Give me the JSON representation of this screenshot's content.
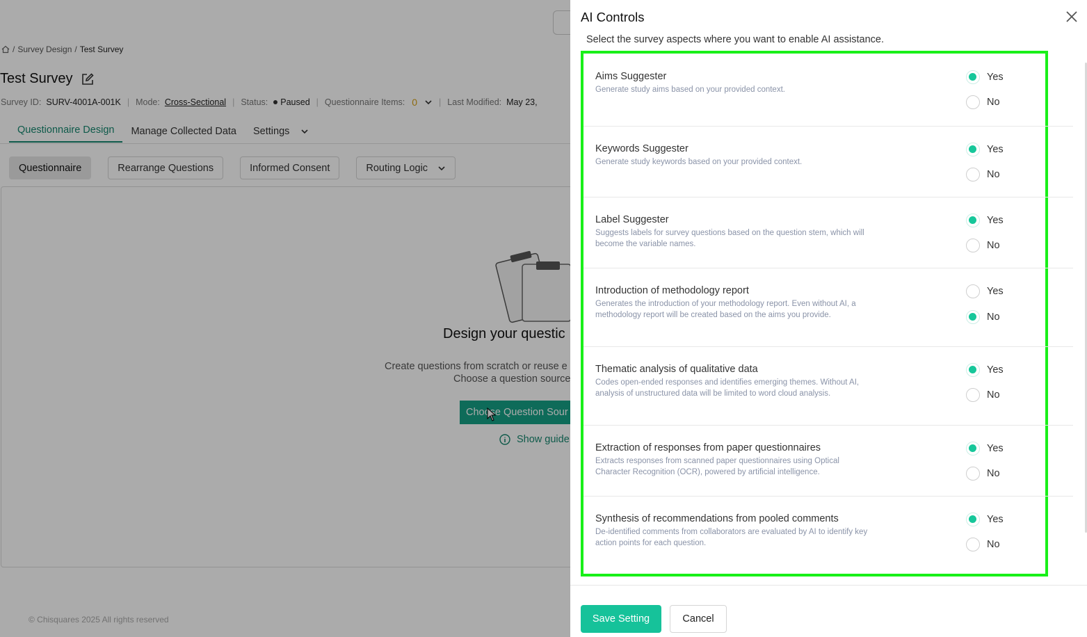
{
  "background": {
    "breadcrumb": [
      "/",
      "Survey Design",
      "/",
      "Test Survey"
    ],
    "title": "Test Survey",
    "meta": {
      "survey_id_label": "Survey ID:",
      "survey_id": "SURV-4001A-001K",
      "mode_label": "Mode:",
      "mode": "Cross-Sectional",
      "status_label": "Status:",
      "status": "Paused",
      "items_label": "Questionnaire Items:",
      "items": "0",
      "modified_label": "Last Modified:",
      "modified": "May 23,"
    },
    "tabs": [
      "Questionnaire Design",
      "Manage Collected Data",
      "Settings"
    ],
    "subtabs": [
      "Questionnaire",
      "Rearrange Questions",
      "Informed Consent",
      "Routing Logic"
    ],
    "empty_title": "Design your questic",
    "empty_desc": "Create questions from scratch or reuse e",
    "empty_desc2": "Choose a question source",
    "choose_button": "Choose Question Sour",
    "guide": "Show guide",
    "footer": "© Chisquares 2025 All rights reserved"
  },
  "drawer": {
    "title": "AI Controls",
    "subtitle": "Select the survey aspects where you want to enable AI assistance.",
    "yes_label": "Yes",
    "no_label": "No",
    "items": [
      {
        "title": "Aims Suggester",
        "desc": "Generate study aims based on your provided context.",
        "selected": "Yes"
      },
      {
        "title": "Keywords Suggester",
        "desc": "Generate study keywords based on your provided context.",
        "selected": "Yes"
      },
      {
        "title": "Label Suggester",
        "desc": "Suggests labels for survey questions based on the question stem, which will become the variable names.",
        "selected": "Yes"
      },
      {
        "title": "Introduction of methodology report",
        "desc": "Generates the introduction of your methodology report. Even without AI, a methodology report will be created based on the aims you provide.",
        "selected": "No"
      },
      {
        "title": "Thematic analysis of qualitative data",
        "desc": "Codes open-ended responses and identifies emerging themes. Without AI, analysis of unstructured data will be limited to word cloud analysis.",
        "selected": "Yes"
      },
      {
        "title": "Extraction of responses from paper questionnaires",
        "desc": "Extracts responses from scanned paper questionnaires using Optical Character Recognition (OCR), powered by artificial intelligence.",
        "selected": "Yes"
      },
      {
        "title": "Synthesis of recommendations from pooled comments",
        "desc": "De-identified comments from collaborators are evaluated by AI to identify key action points for each question.",
        "selected": "Yes"
      }
    ],
    "save_button": "Save Setting",
    "cancel_button": "Cancel"
  },
  "colors": {
    "accent": "#16c29a",
    "highlight_border": "#19f019",
    "tab_active": "#16876f"
  }
}
